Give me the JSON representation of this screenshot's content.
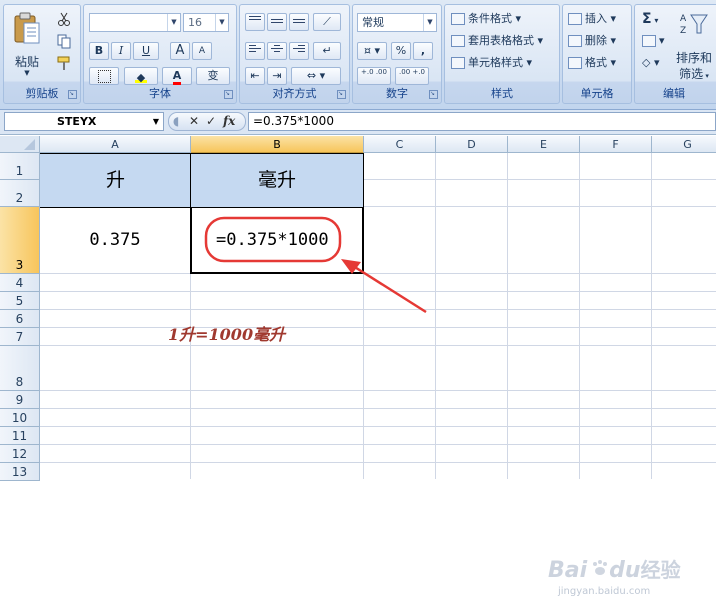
{
  "ribbon": {
    "clipboard": {
      "label": "剪贴板",
      "paste_label": "粘贴"
    },
    "font": {
      "label": "字体",
      "font_name": "",
      "font_size": "16",
      "bold": "B",
      "italic": "I",
      "underline": "U",
      "grow": "A",
      "shrink": "A",
      "font_color": "A",
      "phonetic": "变"
    },
    "alignment": {
      "label": "对齐方式"
    },
    "number": {
      "label": "数字",
      "format": "常规",
      "percent": "%",
      "comma": ",",
      "inc_decimal": "+.0 .00",
      "dec_decimal": ".00 +.0"
    },
    "styles": {
      "label": "样式",
      "conditional": "条件格式",
      "table": "套用表格格式",
      "cell": "单元格样式"
    },
    "cells": {
      "label": "单元格",
      "insert": "插入",
      "delete": "删除",
      "format": "格式"
    },
    "editing": {
      "label": "编辑",
      "sigma": "Σ",
      "sort_filter_1": "排序和",
      "sort_filter_2": "筛选"
    }
  },
  "formula_bar": {
    "name_box": "STEYX",
    "cancel": "✕",
    "enter": "✓",
    "fx": "fx",
    "formula": "=0.375*1000"
  },
  "grid": {
    "columns": [
      "A",
      "B",
      "C",
      "D",
      "E",
      "F",
      "G"
    ],
    "rows": [
      "1",
      "2",
      "3",
      "4",
      "5",
      "6",
      "7",
      "8",
      "9",
      "10",
      "11",
      "12",
      "13"
    ],
    "cells": {
      "A1": "升",
      "B1": "毫升",
      "A3": "0.375",
      "B3": "=0.375*1000"
    }
  },
  "annotation": "1升=1000毫升",
  "watermark": {
    "brand": "Bai",
    "brand2": "du",
    "suffix": "经验",
    "url": "jingyan.baidu.com"
  },
  "colors": {
    "header_fill": "#c5d9f1",
    "selected_header": "#f7c55c",
    "annotation_red": "#e53935",
    "annotation_text": "#a0392f"
  }
}
